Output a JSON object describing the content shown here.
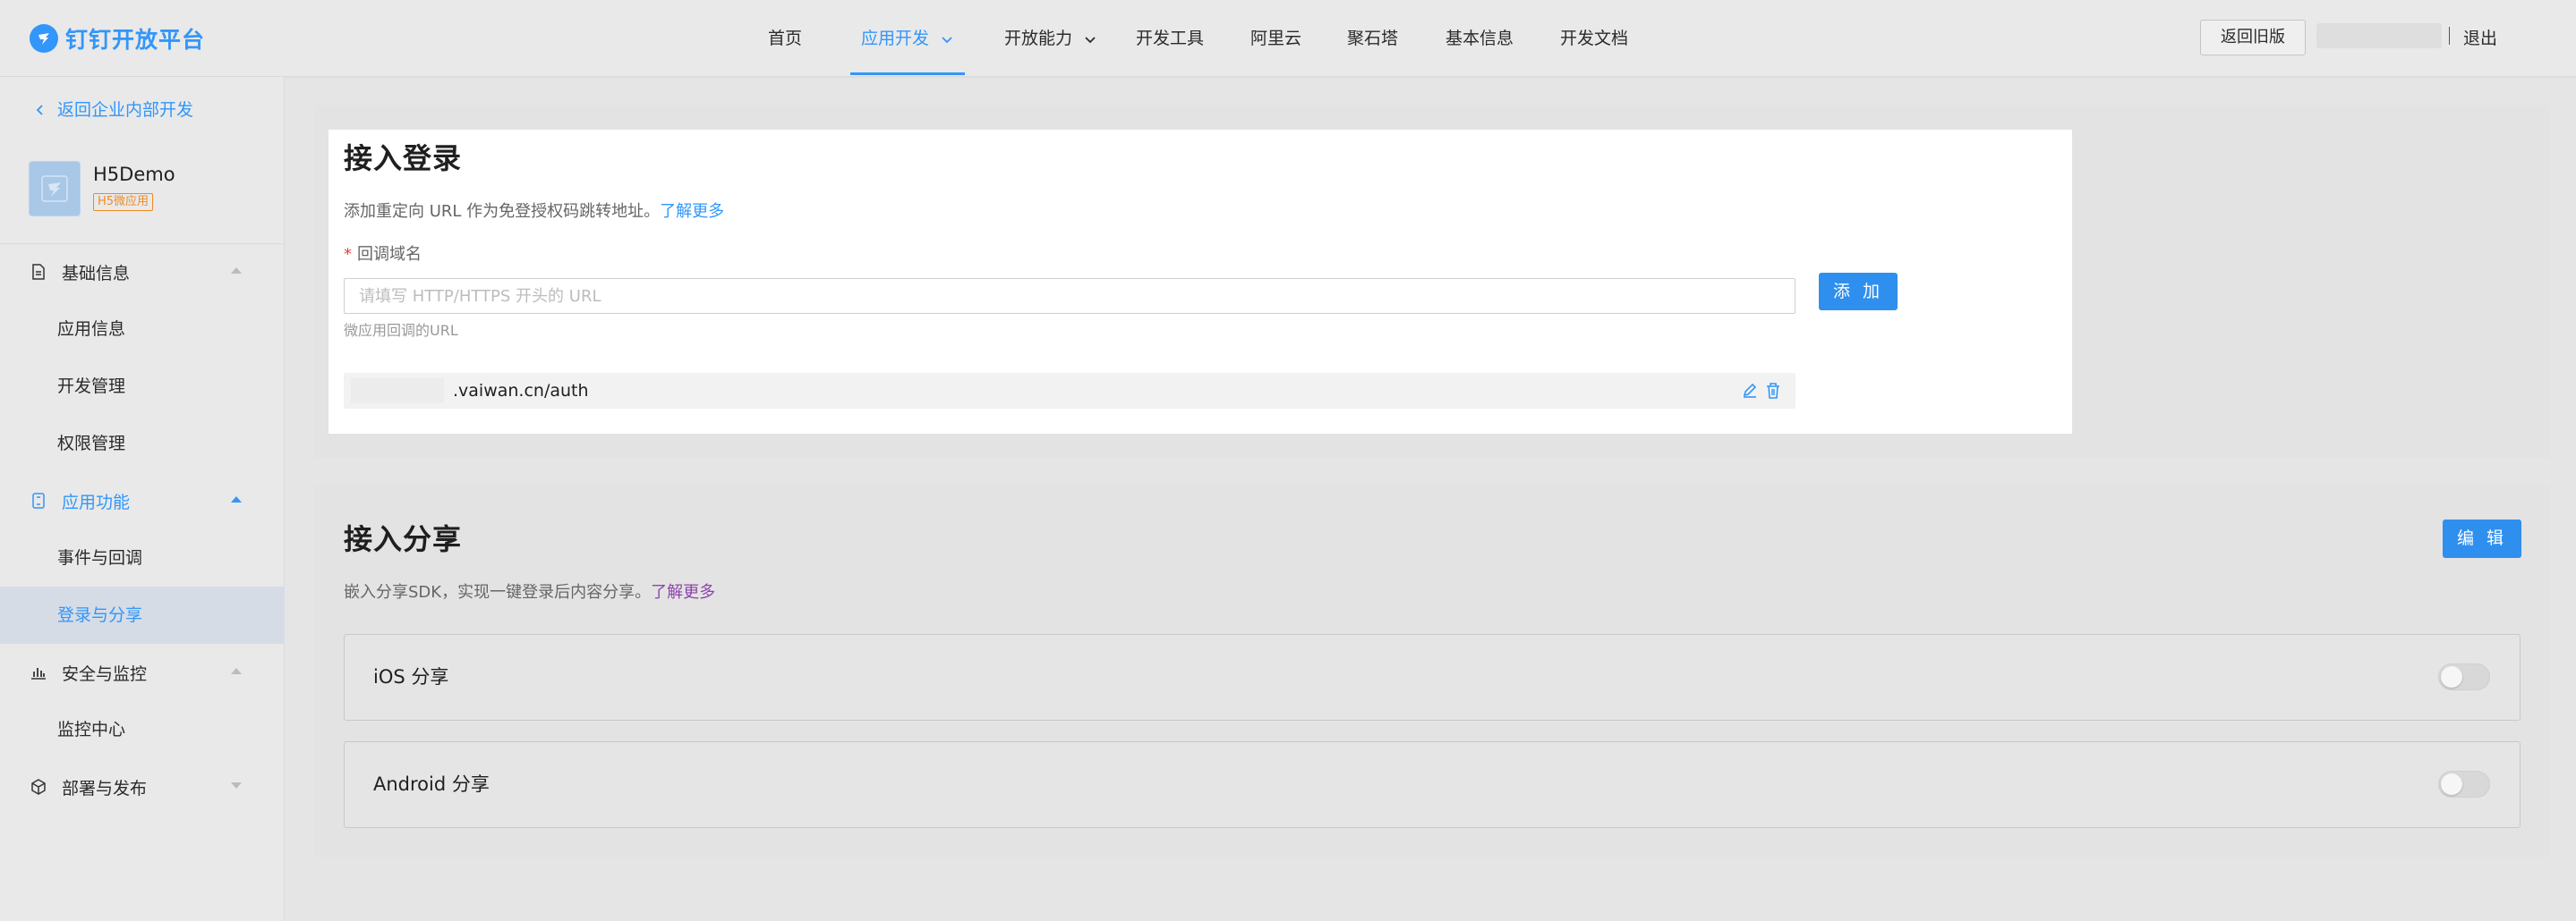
{
  "header": {
    "logo_text": "钉钉开放平台",
    "nav": [
      {
        "label": "首页"
      },
      {
        "label": "应用开发",
        "active": true,
        "dropdown": true
      },
      {
        "label": "开放能力",
        "dropdown": true
      },
      {
        "label": "开发工具"
      },
      {
        "label": "阿里云"
      },
      {
        "label": "聚石塔"
      },
      {
        "label": "基本信息"
      },
      {
        "label": "开发文档"
      }
    ],
    "return_old_label": "返回旧版",
    "logout_label": "退出"
  },
  "sidebar": {
    "back_label": "返回企业内部开发",
    "app": {
      "name": "H5Demo",
      "tag": "H5微应用"
    },
    "sections": [
      {
        "label": "基础信息",
        "icon": "document-icon",
        "items": [
          "应用信息",
          "开发管理",
          "权限管理"
        ]
      },
      {
        "label": "应用功能",
        "icon": "phone-icon",
        "active": true,
        "items": [
          "事件与回调",
          "登录与分享"
        ],
        "selected_item": "登录与分享"
      },
      {
        "label": "安全与监控",
        "icon": "bar-chart-icon",
        "items": [
          "监控中心"
        ]
      },
      {
        "label": "部署与发布",
        "icon": "box-icon",
        "items": []
      }
    ]
  },
  "login_panel": {
    "title": "接入登录",
    "desc": "添加重定向 URL 作为免登授权码跳转地址。",
    "learn_more": "了解更多",
    "field_label": "回调域名",
    "input_placeholder": "请填写 HTTP/HTTPS 开头的 URL",
    "input_value": "",
    "add_label": "添 加",
    "hint": "微应用回调的URL",
    "url_entry": ".vaiwan.cn/auth"
  },
  "share_panel": {
    "title": "接入分享",
    "edit_label": "编 辑",
    "desc": "嵌入分享SDK，实现一键登录后内容分享。",
    "learn_more": "了解更多",
    "items": [
      {
        "label": "iOS 分享",
        "enabled": false
      },
      {
        "label": "Android 分享",
        "enabled": false
      }
    ]
  },
  "colors": {
    "accent": "#3296fa",
    "button": "#2f8fee",
    "required": "#e64340",
    "tag": "#f08a24",
    "selected_bg": "#d6dce6"
  }
}
